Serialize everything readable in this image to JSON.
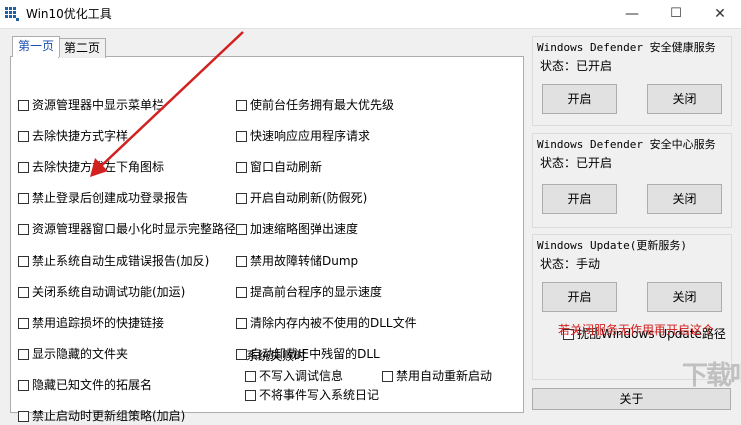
{
  "window": {
    "title": "Win10优化工具",
    "minimize": "—",
    "maximize": "☐",
    "close": "✕"
  },
  "tabs": [
    {
      "label": "第一页"
    },
    {
      "label": "第二页"
    }
  ],
  "options_left": [
    {
      "label": "资源管理器中显示菜单栏",
      "checked": false
    },
    {
      "label": "去除快捷方式字样",
      "checked": false
    },
    {
      "label": "去除快捷方式左下角图标",
      "checked": false
    },
    {
      "label": "禁止登录后创建成功登录报告",
      "checked": false
    },
    {
      "label": "资源管理器窗口最小化时显示完整路径",
      "checked": false
    },
    {
      "label": "禁止系统自动生成错误报告(加反)",
      "checked": false
    },
    {
      "label": "关闭系统自动调试功能(加运)",
      "checked": false
    },
    {
      "label": "禁用追踪损坏的快捷链接",
      "checked": false
    },
    {
      "label": "显示隐藏的文件夹",
      "checked": false
    },
    {
      "label": "隐藏已知文件的拓展名",
      "checked": false
    },
    {
      "label": "禁止启动时更新组策略(加启)",
      "checked": false
    }
  ],
  "options_right": [
    {
      "label": "使前台任务拥有最大优先级",
      "checked": false
    },
    {
      "label": "快速响应应用程序请求",
      "checked": false
    },
    {
      "label": "窗口自动刷新",
      "checked": false
    },
    {
      "label": "开启自动刷新(防假死)",
      "checked": false
    },
    {
      "label": "加速缩略图弹出速度",
      "checked": false
    },
    {
      "label": "禁用故障转储Dump",
      "checked": false
    },
    {
      "label": "提高前台程序的显示速度",
      "checked": false
    },
    {
      "label": "清除内存内被不使用的DLL文件",
      "checked": false
    },
    {
      "label": "自动卸载IE中残留的DLL",
      "checked": false
    }
  ],
  "failure": {
    "legend": "系统失败时",
    "write_debug": "不写入调试信息",
    "auto_restart": "禁用自动重新启动",
    "no_log": "不将事件写入系统日记"
  },
  "services": [
    {
      "title": "Windows Defender 安全健康服务",
      "status": "状态：已开启",
      "on": "开启",
      "off": "关闭"
    },
    {
      "title": "Windows Defender 安全中心服务",
      "status": "状态：已开启",
      "on": "开启",
      "off": "关闭"
    },
    {
      "title": "Windows Update(更新服务)",
      "status": "状态：手动",
      "on": "开启",
      "off": "关闭"
    }
  ],
  "update_path_option": "扰乱Windows Update路径",
  "warning": "若关闭服务无作用再开启这个",
  "about_label": "关于",
  "watermark": "下载吧",
  "colors": {
    "warning": "#d21f1f",
    "active_tab_text": "#1a4fb5",
    "annotation_arrow": "#d32020"
  }
}
